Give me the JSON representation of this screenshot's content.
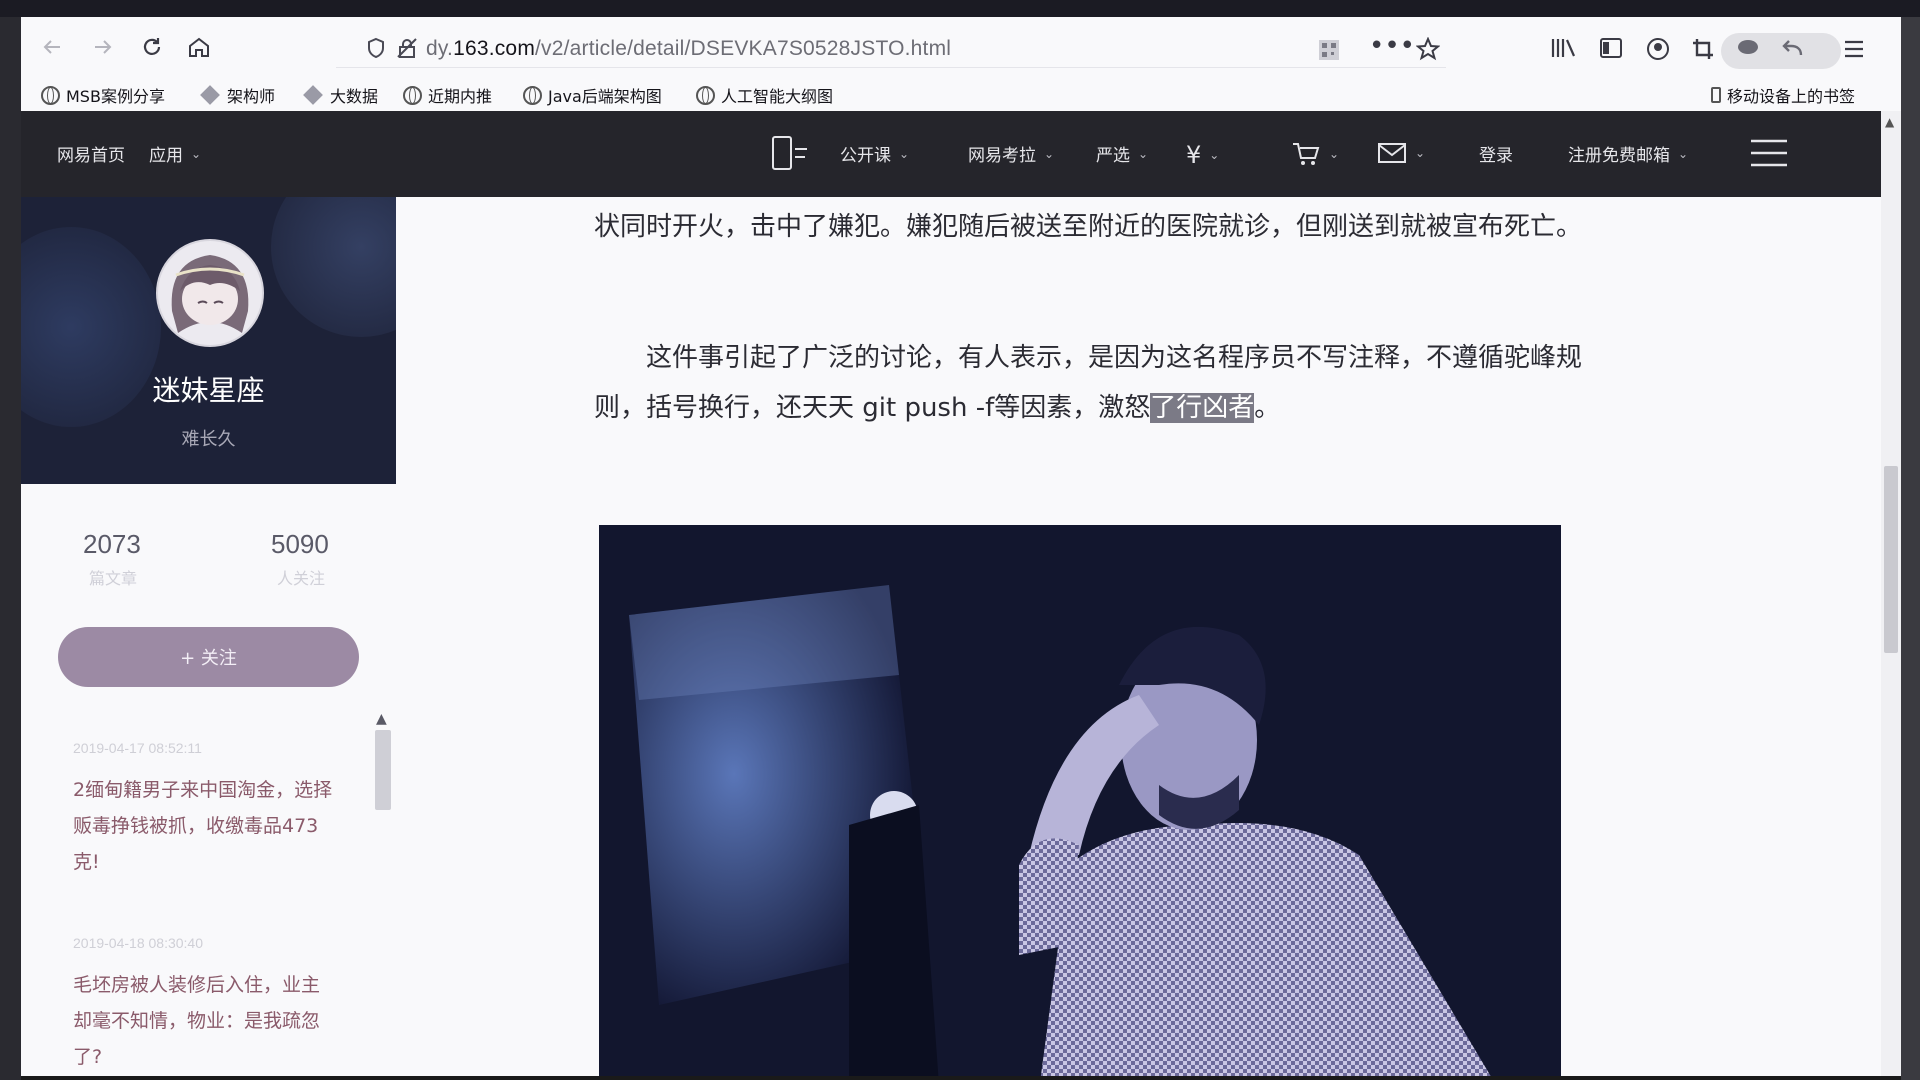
{
  "browser": {
    "url_prefix": "dy.",
    "url_domain": "163.com",
    "url_path": "/v2/article/detail/DSEVKA7S0528JSTO.html",
    "bookmarks": [
      {
        "label": "MSB案例分享",
        "icon": "globe-icon"
      },
      {
        "label": "架构师",
        "icon": "folder-icon"
      },
      {
        "label": "大数据",
        "icon": "folder-icon"
      },
      {
        "label": "近期内推",
        "icon": "globe-icon"
      },
      {
        "label": "Java后端架构图",
        "icon": "globe-icon"
      },
      {
        "label": "人工智能大纲图",
        "icon": "globe-icon"
      }
    ],
    "mobile_bookmarks": "移动设备上的书签"
  },
  "site_header": {
    "home": "网易首页",
    "apps": "应用",
    "open_course": "公开课",
    "kaola": "网易考拉",
    "yanxuan": "严选",
    "login": "登录",
    "register": "注册免费邮箱"
  },
  "profile": {
    "name": "迷妹星座",
    "subtitle": "难长久",
    "stats": [
      {
        "value": "2073",
        "label": "篇文章"
      },
      {
        "value": "5090",
        "label": "人关注"
      }
    ],
    "follow_button": "+ 关注"
  },
  "recent_articles": [
    {
      "date": "2019-04-17 08:52:11",
      "title": "2缅甸籍男子来中国淘金，选择贩毒挣钱被抓，收缴毒品473克!"
    },
    {
      "date": "2019-04-18 08:30:40",
      "title": "毛坯房被人装修后入住，业主却毫不知情，物业：是我疏忽了?"
    }
  ],
  "article": {
    "para1": "状同时开火，击中了嫌犯。嫌犯随后被送至附近的医院就诊，但刚送到就被宣布死亡。",
    "para2_main": "这件事引起了广泛的讨论，有人表示，是因为这名程序员不写注释，不遵循驼峰规则，括号换行，还天天 git push -f等因素，激怒",
    "para2_highlight": "了行凶者",
    "para2_end": "。"
  },
  "colors": {
    "site_header_bg": "#25252b",
    "follow_button_bg": "#9c8aa4",
    "highlight_bg": "#7b7a86"
  }
}
